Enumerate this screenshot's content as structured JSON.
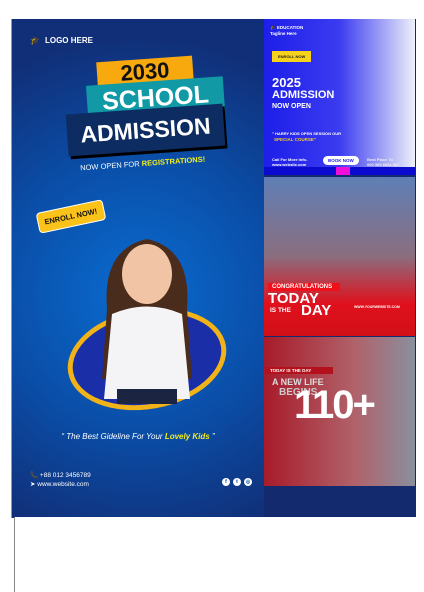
{
  "poster": {
    "logo": "LOGO HERE",
    "year": "2030",
    "school": "SCHOOL",
    "admission": "ADMISSION",
    "now_open": "NOW OPEN FOR",
    "registrations": "REGISTRATIONS!",
    "enroll": "ENROLL NOW!",
    "quote_start": "“ The Best Gideline For Your",
    "quote_hl": "Lovely Kids",
    "quote_end": " ”",
    "phone": "+88 012 3456789",
    "website": "www.website.com"
  },
  "thumb1": {
    "brand": "EDUCATION",
    "tagline": "Tagline Here",
    "enroll": "ENROLL NOW",
    "year": "2025",
    "admission": "ADMISSION",
    "now_open": "NOW OPEN",
    "line1": "\" HARRY KIDS OPEN SESSION OUR",
    "line2": "SPECIAL COURSE\"",
    "call": "Call For More Info-",
    "web": "www.website.com",
    "book": "BOOK NOW",
    "best": "Best Place To",
    "num": "000 365 6834 587"
  },
  "thumb2": {
    "congrats": "CONGRATULATIONS",
    "today": "TODAY",
    "isthe": "IS THE",
    "day": "DAY",
    "web": "WWW.YOURWEBSITE.COM"
  },
  "thumb3": {
    "today": "TODAY IS THE DAY",
    "anew": "A NEW LIFE",
    "begins": "BEGINS",
    "count": "110+"
  }
}
